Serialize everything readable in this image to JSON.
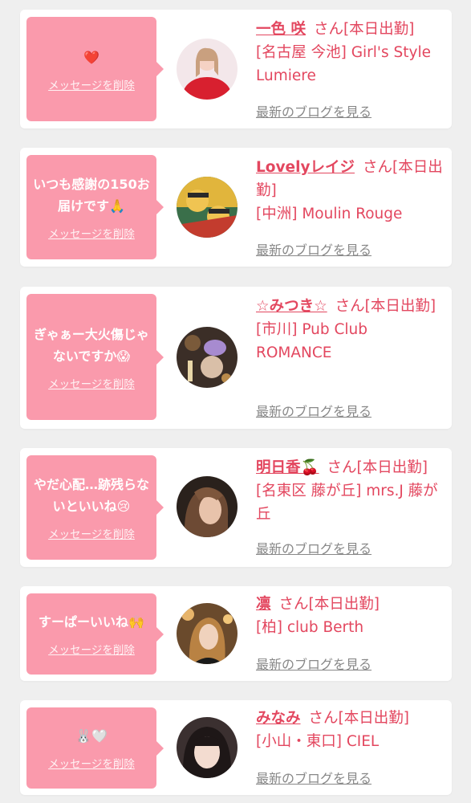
{
  "accent_color": "#fa9aac",
  "name_color": "#e3475f",
  "entries": [
    {
      "message": "❤️",
      "delete_label": "メッセージを削除",
      "name": "一色 咲",
      "suffix": "さん[本日出勤]",
      "shop": "[名古屋 今池] Girl's Style Lumiere",
      "blog_label": "最新のブログを見る"
    },
    {
      "message": "いつも感謝の150お届けです🙏",
      "delete_label": "メッセージを削除",
      "name": "Lovelyレイジ",
      "suffix": "さん[本日出勤]",
      "shop": "[中洲] Moulin Rouge",
      "blog_label": "最新のブログを見る"
    },
    {
      "message": "ぎゃぁー大火傷じゃないですか😱",
      "delete_label": "メッセージを削除",
      "name": "☆みつき☆",
      "suffix": "さん[本日出勤]",
      "shop": "[市川] Pub Club ROMANCE",
      "blog_label": "最新のブログを見る"
    },
    {
      "message": "やだ心配…跡残らないといいね😢",
      "delete_label": "メッセージを削除",
      "name": "明日香🍒",
      "suffix": "さん[本日出勤]",
      "shop": "[名東区 藤が丘] mrs.J 藤が丘",
      "blog_label": "最新のブログを見る"
    },
    {
      "message": "すーぱーいいね🙌",
      "delete_label": "メッセージを削除",
      "name": "凛",
      "suffix": "さん[本日出勤]",
      "shop": "[柏] club Berth",
      "blog_label": "最新のブログを見る"
    },
    {
      "message": "🐰🤍",
      "delete_label": "メッセージを削除",
      "name": "みなみ",
      "suffix": "さん[本日出勤]",
      "shop": "[小山・東口] CIEL",
      "blog_label": "最新のブログを見る"
    }
  ]
}
